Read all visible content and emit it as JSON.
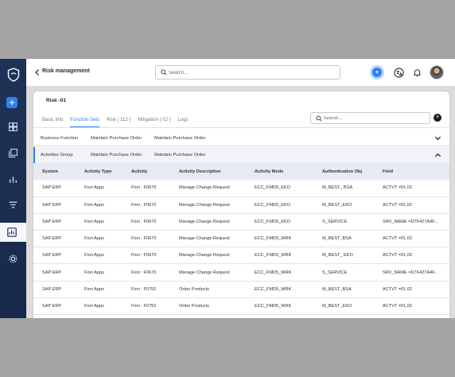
{
  "header": {
    "title": "Risk management",
    "search_placeholder": "Search..."
  },
  "card": {
    "title": "Risk -01",
    "tabs": [
      {
        "label": "Basic Info"
      },
      {
        "label": "Function Sets"
      },
      {
        "label": "Risk ( 112 )"
      },
      {
        "label": "Mitigation ( 02 )"
      },
      {
        "label": "Logs"
      }
    ],
    "active_tab": "Function Sets",
    "search_placeholder": "Search..."
  },
  "groups": [
    {
      "label": "Business Function",
      "col1": "Maintain Purchase Order",
      "col2": "Maintain Purchase Order",
      "expanded": false
    },
    {
      "label": "Activities Group",
      "col1": "Maintain Purchase Order",
      "col2": "Maintain Purchase Order",
      "expanded": true
    }
  ],
  "table": {
    "columns": [
      "System",
      "Activity Type",
      "Activity",
      "Activity Description",
      "Activity Mode",
      "Authentication Obj",
      "Field"
    ],
    "rows": [
      [
        "SAP ERP",
        "Fiori Apps",
        "Fiori : F0670",
        "Manage Change Request",
        "ECC_FMD5_EKO",
        "M_BEST_ BSA",
        "ACTVT =01,02"
      ],
      [
        "SAP ERP",
        "Fiori Apps",
        "Fiori : F0670",
        "Manage Change Request",
        "ECC_FMD5_EKO",
        "M_BEST_EKO",
        "ACTVT =01,02"
      ],
      [
        "SAP ERP",
        "Fiori Apps",
        "Fiori : F0670",
        "Manage Change Request",
        "ECC_FMD5_EKO",
        "S_SERVICE",
        "SRV_NAME =D7F427A4F..."
      ],
      [
        "SAP ERP",
        "Fiori Apps",
        "Fiori : F0670",
        "Manage Change Request",
        "ECC_FMD5_WRK",
        "M_BEST_BSA",
        "ACTVT =01,02"
      ],
      [
        "SAP ERP",
        "Fiori Apps",
        "Fiori : F0670",
        "Manage Change Request",
        "ECC_FMD5_WRK",
        "M_BEST_ EKO",
        "ACTVT =01,02"
      ],
      [
        "SAP ERP",
        "Fiori Apps",
        "Fiori : F0670",
        "Manage Change Request",
        "ECC_FMD5_WRK",
        "S_SERVICE",
        "SRV_NAME =D7F427A4F..."
      ],
      [
        "SAP ERP",
        "Fiori Apps",
        "Fiori : F0752",
        "Order Products",
        "ECC_FMD5_WRK",
        "M_BEST_BSA",
        "ACTVT =01,02"
      ],
      [
        "SAP ERP",
        "Fiori Apps",
        "Fiori : F0752",
        "Order Products",
        "ECC_FMD5_WRK",
        "M_BEST_EKO",
        "ACTVT =01,02"
      ]
    ]
  },
  "sidebar": {
    "items": [
      {
        "icon": "add-icon"
      },
      {
        "icon": "dashboard-icon"
      },
      {
        "icon": "copy-icon"
      },
      {
        "icon": "bar-chart-icon"
      },
      {
        "icon": "filter-icon"
      },
      {
        "icon": "risk-analysis-icon"
      },
      {
        "icon": "settings-icon"
      }
    ]
  },
  "colors": {
    "accent": "#2f7ff7",
    "sidebar": "#1f3358",
    "table_header": "#e6eaf2"
  }
}
